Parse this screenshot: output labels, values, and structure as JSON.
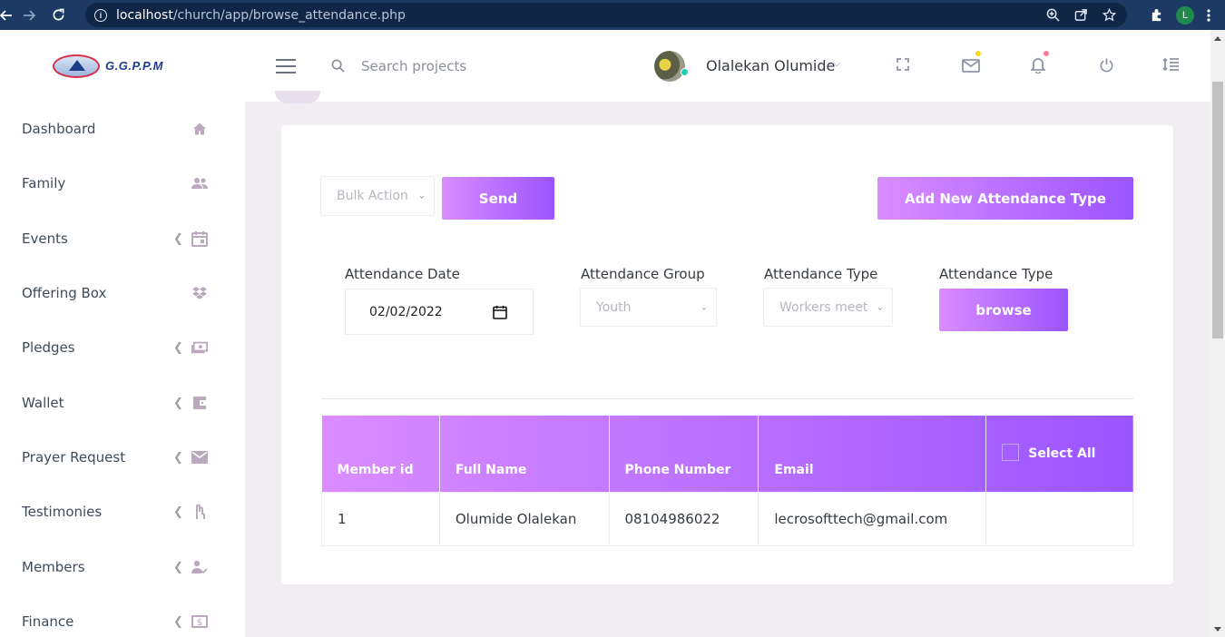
{
  "browser": {
    "url_host": "localhost",
    "url_path": "/church/app/browse_attendance.php",
    "profile_initial": "L"
  },
  "sidebar": {
    "logo_text": "G.G.P.P.M",
    "items": [
      {
        "label": "Dashboard",
        "icon": "home-icon",
        "has_chevron": false
      },
      {
        "label": "Family",
        "icon": "people-icon",
        "has_chevron": false
      },
      {
        "label": "Events",
        "icon": "calendar-icon",
        "has_chevron": true
      },
      {
        "label": "Offering Box",
        "icon": "dropbox-icon",
        "has_chevron": false
      },
      {
        "label": "Pledges",
        "icon": "cash-icon",
        "has_chevron": true
      },
      {
        "label": "Wallet",
        "icon": "wallet-icon",
        "has_chevron": true
      },
      {
        "label": "Prayer Request",
        "icon": "mail-icon",
        "has_chevron": true
      },
      {
        "label": "Testimonies",
        "icon": "hand-icon",
        "has_chevron": true
      },
      {
        "label": "Members",
        "icon": "user-check-icon",
        "has_chevron": true
      },
      {
        "label": "Finance",
        "icon": "dollar-box-icon",
        "has_chevron": true
      }
    ]
  },
  "topnav": {
    "search_placeholder": "Search projects",
    "user_name": "Olalekan Olumide"
  },
  "actions": {
    "bulk_action_placeholder": "Bulk Action",
    "send_label": "Send",
    "add_type_label": "Add New Attendance Type"
  },
  "filters": {
    "date_label": "Attendance Date",
    "date_value": "02/02/2022",
    "group_label": "Attendance Group",
    "group_value": "Youth",
    "type_label": "Attendance Type",
    "type_value": "Workers meet",
    "browse_label": "Attendance Type",
    "browse_button": "browse"
  },
  "table": {
    "headers": [
      "Member id",
      "Full Name",
      "Phone Number",
      "Email",
      "Select All"
    ],
    "rows": [
      [
        "1",
        "Olumide Olalekan",
        "08104986022",
        "lecrosofttech@gmail.com",
        ""
      ]
    ]
  },
  "colors": {
    "gradient_start": "#da8cff",
    "gradient_end": "#9a55ff",
    "browser_bar": "#1c3a64",
    "page_bg": "#f2edf3"
  }
}
